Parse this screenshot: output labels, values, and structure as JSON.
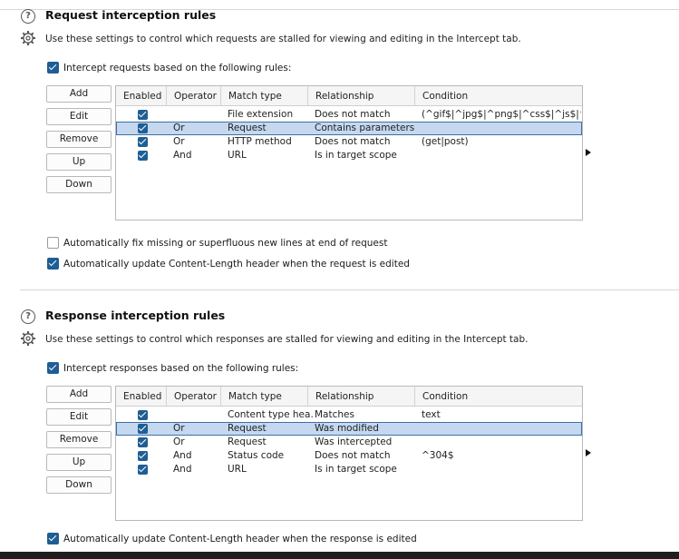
{
  "request_section": {
    "title": "Request interception rules",
    "description": "Use these settings to control which requests are stalled for viewing and editing in the Intercept tab.",
    "intercept_checkbox_label": "Intercept requests based on the following rules:",
    "buttons": [
      "Add",
      "Edit",
      "Remove",
      "Up",
      "Down"
    ],
    "columns": [
      "Enabled",
      "Operator",
      "Match type",
      "Relationship",
      "Condition"
    ],
    "rows": [
      {
        "enabled": true,
        "operator": "",
        "match_type": "File extension",
        "relationship": "Does not match",
        "condition": "(^gif$|^jpg$|^png$|^css$|^js$|^ic..."
      },
      {
        "enabled": true,
        "operator": "Or",
        "match_type": "Request",
        "relationship": "Contains parameters",
        "condition": ""
      },
      {
        "enabled": true,
        "operator": "Or",
        "match_type": "HTTP method",
        "relationship": "Does not match",
        "condition": "(get|post)"
      },
      {
        "enabled": true,
        "operator": "And",
        "match_type": "URL",
        "relationship": "Is in target scope",
        "condition": ""
      }
    ],
    "selected_row": 1,
    "option_fix_newlines": "Automatically fix missing or superfluous new lines at end of request",
    "option_update_length": "Automatically update Content-Length header when the request is edited"
  },
  "response_section": {
    "title": "Response interception rules",
    "description": "Use these settings to control which responses are stalled for viewing and editing in the Intercept tab.",
    "intercept_checkbox_label": "Intercept responses based on the following rules:",
    "buttons": [
      "Add",
      "Edit",
      "Remove",
      "Up",
      "Down"
    ],
    "columns": [
      "Enabled",
      "Operator",
      "Match type",
      "Relationship",
      "Condition"
    ],
    "rows": [
      {
        "enabled": true,
        "operator": "",
        "match_type": "Content type hea...",
        "relationship": "Matches",
        "condition": "text"
      },
      {
        "enabled": true,
        "operator": "Or",
        "match_type": "Request",
        "relationship": "Was modified",
        "condition": ""
      },
      {
        "enabled": true,
        "operator": "Or",
        "match_type": "Request",
        "relationship": "Was intercepted",
        "condition": ""
      },
      {
        "enabled": true,
        "operator": "And",
        "match_type": "Status code",
        "relationship": "Does not match",
        "condition": "^304$"
      },
      {
        "enabled": true,
        "operator": "And",
        "match_type": "URL",
        "relationship": "Is in target scope",
        "condition": ""
      }
    ],
    "selected_row": 1,
    "option_update_length": "Automatically update Content-Length header when the response is edited"
  },
  "icons": {
    "help": "help-circle-icon",
    "settings": "gear-icon",
    "expand": "triangle-right-icon"
  },
  "colors": {
    "accent": "#1f5e94",
    "selection": "#c5d8ef",
    "selection_border": "#3d6fa8"
  }
}
